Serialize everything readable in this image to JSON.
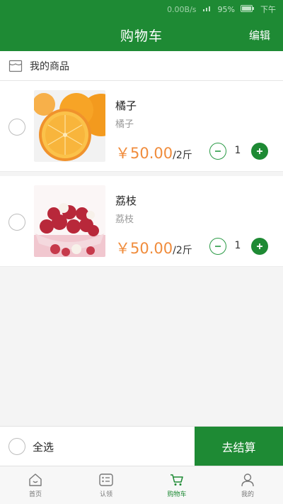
{
  "status_bar": {
    "speed": "0.00B/s",
    "battery": "95%",
    "time": "下午"
  },
  "header": {
    "title": "购物车",
    "edit_label": "编辑"
  },
  "section": {
    "label": "我的商品"
  },
  "items": [
    {
      "name": "橘子",
      "spec": "橘子",
      "price": "￥50.00",
      "unit": "/2斤",
      "qty": "1"
    },
    {
      "name": "荔枝",
      "spec": "荔枝",
      "price": "￥50.00",
      "unit": "/2斤",
      "qty": "1"
    }
  ],
  "footer": {
    "select_all": "全选",
    "checkout": "去结算"
  },
  "tabs": [
    {
      "label": "首页",
      "icon": "home-icon"
    },
    {
      "label": "认领",
      "icon": "claim-icon"
    },
    {
      "label": "购物车",
      "icon": "cart-icon"
    },
    {
      "label": "我的",
      "icon": "user-icon"
    }
  ],
  "colors": {
    "brand": "#1e8a34",
    "price": "#f08c3c"
  }
}
